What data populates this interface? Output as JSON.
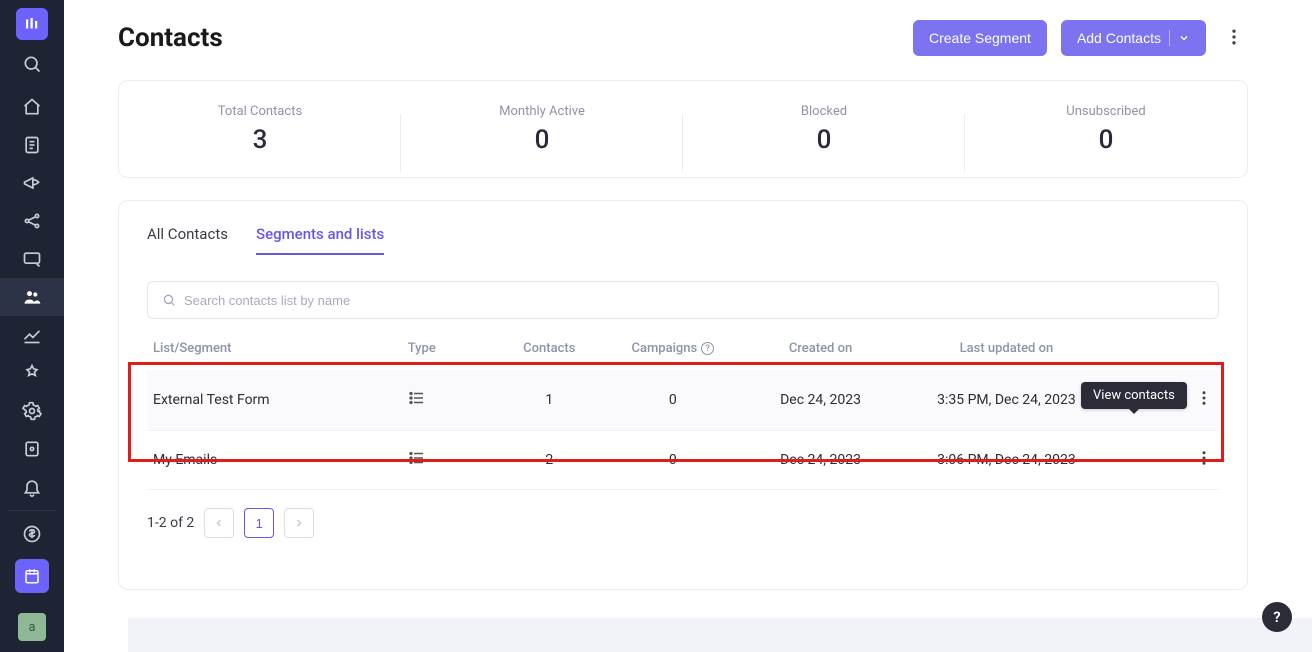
{
  "page": {
    "title": "Contacts"
  },
  "header": {
    "create_segment": "Create Segment",
    "add_contacts": "Add Contacts"
  },
  "stats": [
    {
      "label": "Total Contacts",
      "value": "3"
    },
    {
      "label": "Monthly Active",
      "value": "0"
    },
    {
      "label": "Blocked",
      "value": "0"
    },
    {
      "label": "Unsubscribed",
      "value": "0"
    }
  ],
  "tabs": {
    "all": "All Contacts",
    "segments": "Segments and lists"
  },
  "search": {
    "placeholder": "Search contacts list by name"
  },
  "table": {
    "headers": {
      "name": "List/Segment",
      "type": "Type",
      "contacts": "Contacts",
      "campaigns": "Campaigns",
      "created": "Created on",
      "updated": "Last updated on"
    },
    "rows": [
      {
        "name": "External Test Form",
        "contacts": "1",
        "campaigns": "0",
        "created": "Dec 24, 2023",
        "updated": "3:35 PM, Dec 24, 2023"
      },
      {
        "name": "My Emails",
        "contacts": "2",
        "campaigns": "0",
        "created": "Dec 24, 2023",
        "updated": "3:06 PM, Dec 24, 2023"
      }
    ]
  },
  "tooltip": {
    "view_contacts": "View contacts"
  },
  "pager": {
    "info": "1-2 of 2",
    "current": "1"
  },
  "sidebar": {
    "avatar_initial": "a",
    "icons": [
      "search-icon",
      "home-icon",
      "document-icon",
      "megaphone-icon",
      "share-icon",
      "screen-icon",
      "contacts-icon",
      "chart-icon",
      "automation-icon",
      "settings-icon",
      "template-icon",
      "bell-icon",
      "billing-icon",
      "calendar-icon"
    ]
  },
  "help": {
    "glyph": "?"
  }
}
